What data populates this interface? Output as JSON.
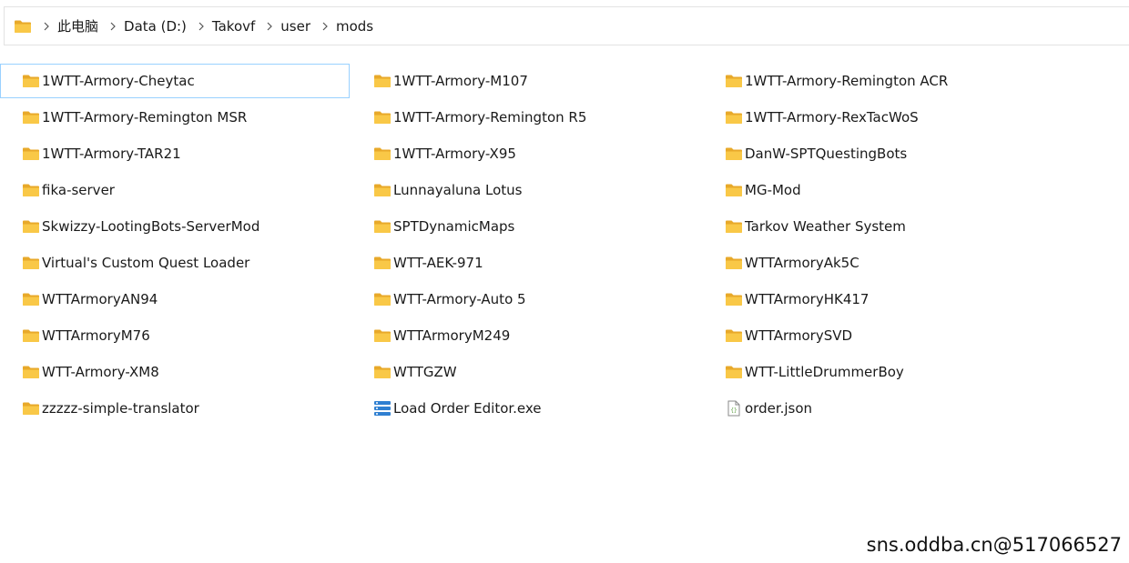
{
  "breadcrumb": {
    "segments": [
      "此电脑",
      "Data (D:)",
      "Takovf",
      "user",
      "mods"
    ]
  },
  "selected_item": "1WTT-Armory-Cheytac",
  "items": [
    {
      "name": "1WTT-Armory-Cheytac",
      "type": "folder"
    },
    {
      "name": "1WTT-Armory-M107",
      "type": "folder"
    },
    {
      "name": "1WTT-Armory-Remington ACR",
      "type": "folder"
    },
    {
      "name": "1WTT-Armory-Remington MSR",
      "type": "folder"
    },
    {
      "name": "1WTT-Armory-Remington R5",
      "type": "folder"
    },
    {
      "name": "1WTT-Armory-RexTacWoS",
      "type": "folder"
    },
    {
      "name": "1WTT-Armory-TAR21",
      "type": "folder"
    },
    {
      "name": "1WTT-Armory-X95",
      "type": "folder"
    },
    {
      "name": "DanW-SPTQuestingBots",
      "type": "folder"
    },
    {
      "name": "fika-server",
      "type": "folder"
    },
    {
      "name": "Lunnayaluna Lotus",
      "type": "folder"
    },
    {
      "name": "MG-Mod",
      "type": "folder"
    },
    {
      "name": "Skwizzy-LootingBots-ServerMod",
      "type": "folder"
    },
    {
      "name": "SPTDynamicMaps",
      "type": "folder"
    },
    {
      "name": "Tarkov Weather System",
      "type": "folder"
    },
    {
      "name": "Virtual's Custom Quest Loader",
      "type": "folder"
    },
    {
      "name": "WTT-AEK-971",
      "type": "folder"
    },
    {
      "name": "WTTArmoryAk5C",
      "type": "folder"
    },
    {
      "name": "WTTArmoryAN94",
      "type": "folder"
    },
    {
      "name": "WTT-Armory-Auto 5",
      "type": "folder"
    },
    {
      "name": "WTTArmoryHK417",
      "type": "folder"
    },
    {
      "name": "WTTArmoryM76",
      "type": "folder"
    },
    {
      "name": "WTTArmoryM249",
      "type": "folder"
    },
    {
      "name": "WTTArmorySVD",
      "type": "folder"
    },
    {
      "name": "WTT-Armory-XM8",
      "type": "folder"
    },
    {
      "name": "WTTGZW",
      "type": "folder"
    },
    {
      "name": "WTT-LittleDrummerBoy",
      "type": "folder"
    },
    {
      "name": "zzzzz-simple-translator",
      "type": "folder"
    },
    {
      "name": "Load Order Editor.exe",
      "type": "exe"
    },
    {
      "name": "order.json",
      "type": "json"
    }
  ],
  "colors": {
    "folder": "#f9c847",
    "folder_back": "#e8a92a",
    "selected_border": "#99d1ff",
    "exe": "#2f7fd1"
  },
  "watermark": "sns.oddba.cn@517066527"
}
